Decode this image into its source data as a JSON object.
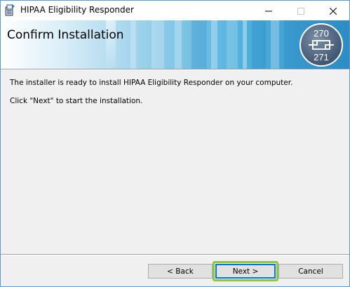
{
  "window": {
    "title": "HIPAA Eligibility Responder",
    "icon": "installer-app-icon"
  },
  "title_bar_controls": {
    "minimize_icon": "minimize-icon",
    "maximize_icon": "maximize-icon",
    "close_icon": "close-icon"
  },
  "banner": {
    "heading": "Confirm Installation",
    "logo_top_text": "270",
    "logo_bottom_text": "271"
  },
  "body": {
    "line1": "The installer is ready to install HIPAA Eligibility Responder on your computer.",
    "line2": "Click \"Next\" to start the installation."
  },
  "buttons": {
    "back_label": "< Back",
    "next_label": "Next >",
    "cancel_label": "Cancel"
  },
  "colors": {
    "banner_blue": "#3fa3d6",
    "focus_ring": "#8ec63f",
    "default_button_border": "#0078d7"
  }
}
